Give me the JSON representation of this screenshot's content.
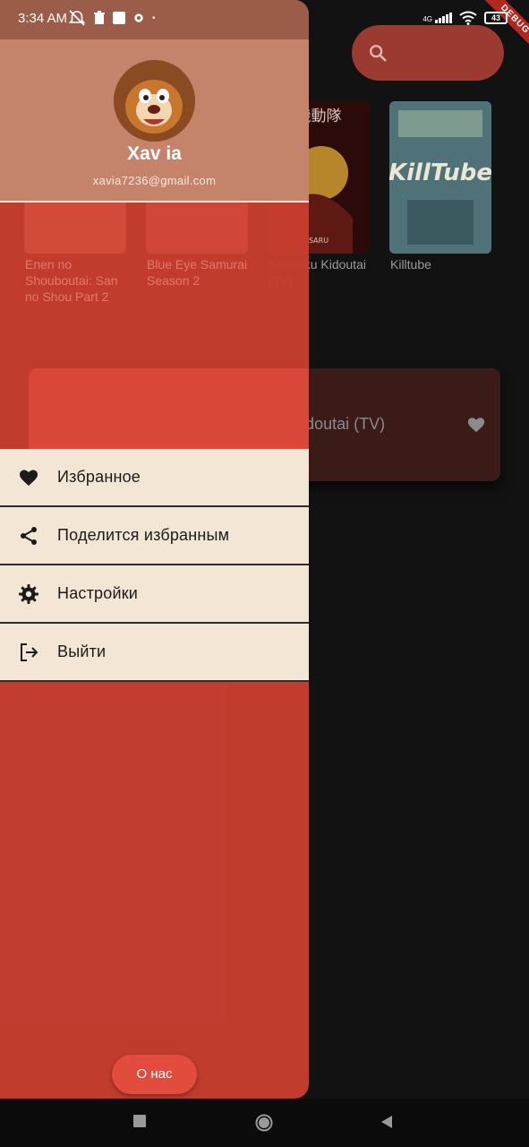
{
  "status_bar": {
    "time": "3:34 AM",
    "network": "4G",
    "battery": "43"
  },
  "debug_banner": "DEBUG",
  "background": {
    "posters": [
      {
        "title": "Enen no Shouboutai: San no Shou Part 2"
      },
      {
        "title": "Blue Eye Samurai Season 2"
      },
      {
        "title": "Koukaku Kidoutai (TV)"
      },
      {
        "title": "Killtube"
      }
    ],
    "favorite_card": {
      "title": "Koukaku Kidoutai (TV)"
    }
  },
  "drawer": {
    "user": {
      "name": "Xav ia",
      "email": "xavia7236@gmail.com"
    },
    "menu": [
      {
        "label": "Избранное",
        "icon": "heart-icon"
      },
      {
        "label": "Поделится избранным",
        "icon": "share-icon"
      },
      {
        "label": "Настройки",
        "icon": "gear-icon"
      },
      {
        "label": "Выйти",
        "icon": "logout-icon"
      }
    ],
    "about_button": "О нас"
  },
  "colors": {
    "drawer": "#c83e30",
    "header": "#c5836b",
    "menu_bg": "#f4e6d4",
    "accent_button": "#e14c3d"
  }
}
